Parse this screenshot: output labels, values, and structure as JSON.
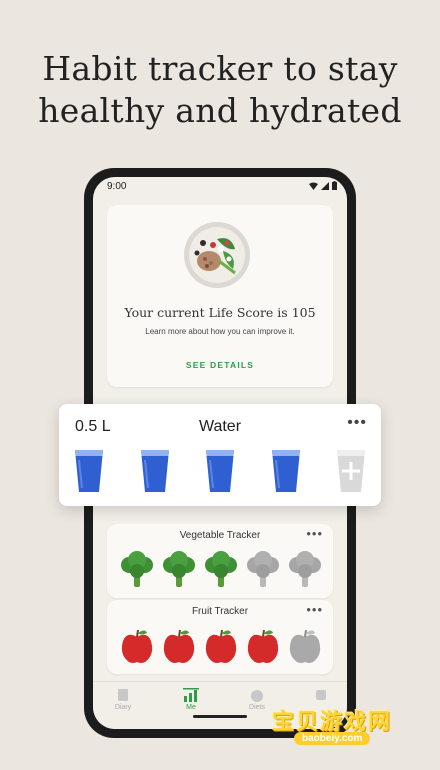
{
  "headline": {
    "line1": "Habit tracker to stay",
    "line2": "healthy and hydrated"
  },
  "status_bar": {
    "time": "9:00"
  },
  "life_score": {
    "title": "Your current Life Score is 105",
    "subtitle": "Learn more about how you can improve it.",
    "action": "SEE DETAILS"
  },
  "water": {
    "amount": "0.5 L",
    "title": "Water",
    "more": "•••",
    "glasses_filled": 4,
    "glasses_total": 5,
    "fill_color": "#2f5fd0"
  },
  "vegetable_tracker": {
    "title": "Vegetable Tracker",
    "more": "•••",
    "filled": 3,
    "total": 5
  },
  "fruit_tracker": {
    "title": "Fruit Tracker",
    "more": "•••",
    "filled": 4,
    "total": 5
  },
  "nav": {
    "items": [
      {
        "label": "Diary",
        "icon": "diary-icon"
      },
      {
        "label": "Me",
        "icon": "bar-chart-icon"
      },
      {
        "label": "Diets",
        "icon": "apple-icon"
      },
      {
        "label": "",
        "icon": "more-icon"
      }
    ],
    "active_color": "#2e9d4a"
  },
  "watermark": {
    "text": "宝贝游戏网",
    "sub": "baobeiy.com"
  }
}
